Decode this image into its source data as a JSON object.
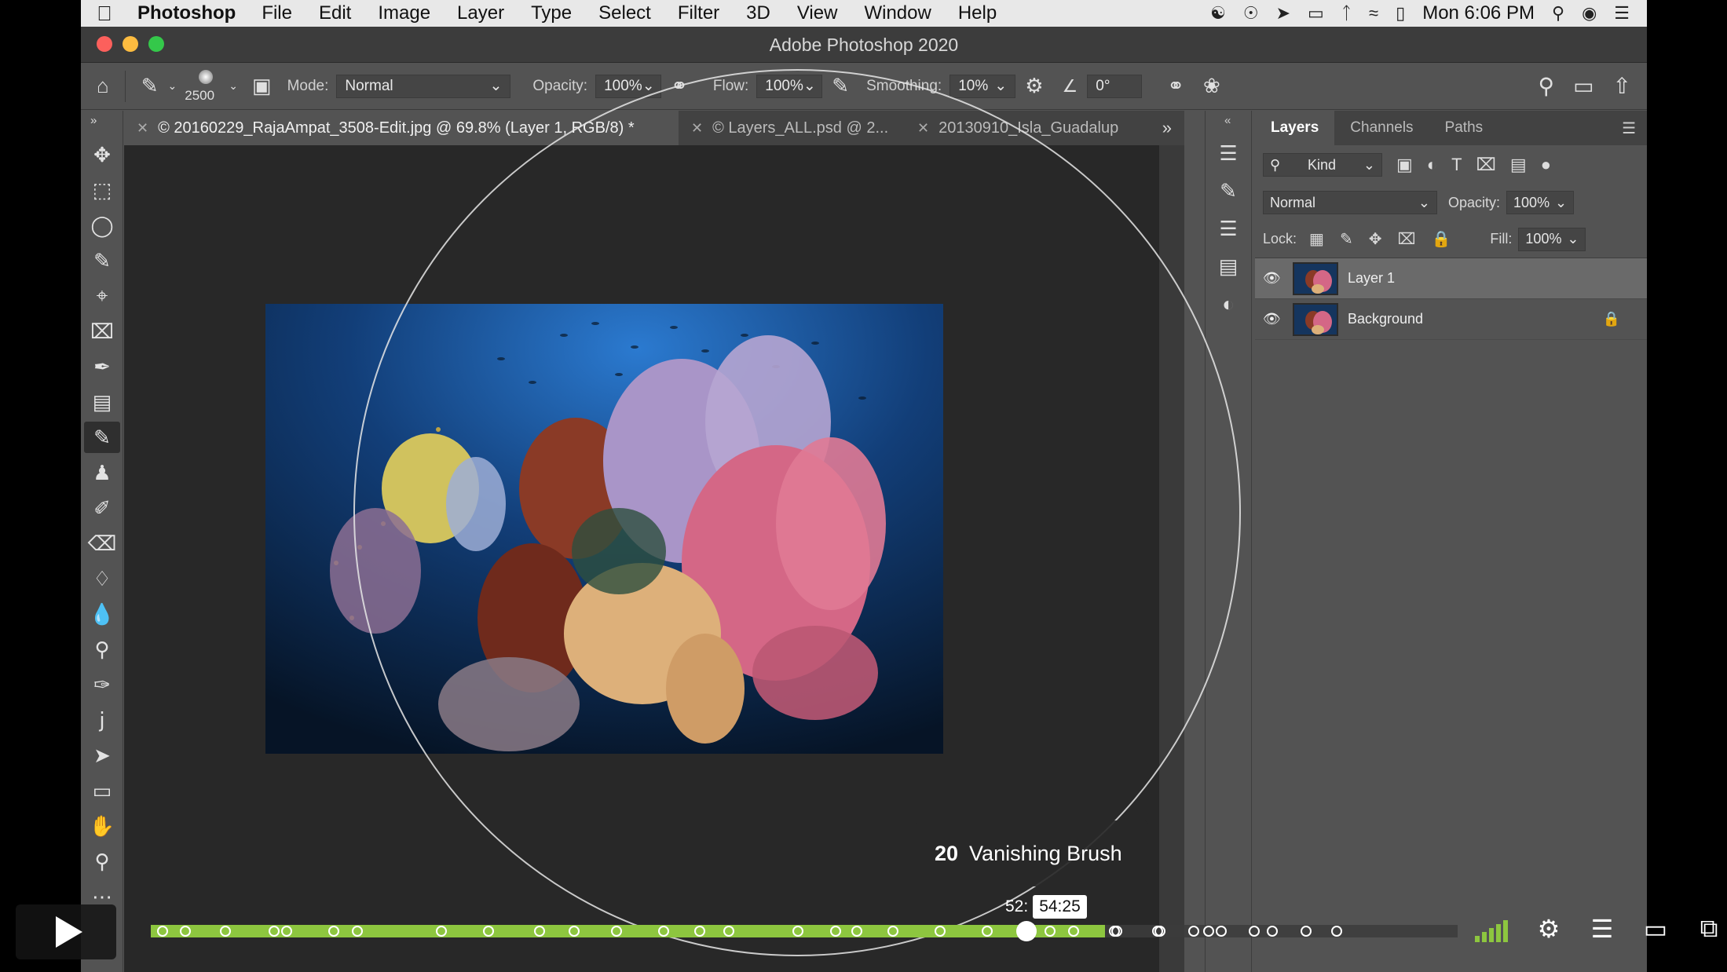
{
  "menubar": {
    "apple": "",
    "app_name": "Photoshop",
    "items": [
      "File",
      "Edit",
      "Image",
      "Layer",
      "Type",
      "Select",
      "Filter",
      "3D",
      "View",
      "Window",
      "Help"
    ],
    "clock": "Mon 6:06 PM"
  },
  "window": {
    "title": "Adobe Photoshop 2020"
  },
  "options": {
    "brush_size": "2500",
    "mode_label": "Mode:",
    "mode_value": "Normal",
    "opacity_label": "Opacity:",
    "opacity_value": "100%",
    "flow_label": "Flow:",
    "flow_value": "100%",
    "smoothing_label": "Smoothing:",
    "smoothing_value": "10%",
    "angle_value": "0°"
  },
  "tabs": [
    {
      "label": "© 20160229_RajaAmpat_3508-Edit.jpg @ 69.8% (Layer 1, RGB/8) *"
    },
    {
      "label": "© Layers_ALL.psd @ 2..."
    },
    {
      "label": "20130910_Isla_Guadalup"
    }
  ],
  "layers_panel": {
    "tabs": [
      "Layers",
      "Channels",
      "Paths"
    ],
    "filter_kind": "Kind",
    "blend_mode": "Normal",
    "opacity_label": "Opacity:",
    "opacity_value": "100%",
    "lock_label": "Lock:",
    "fill_label": "Fill:",
    "fill_value": "100%",
    "layers": [
      {
        "name": "Layer 1",
        "selected": true
      },
      {
        "name": "Background",
        "selected": false,
        "locked": true
      }
    ]
  },
  "player": {
    "chapter_number": "20",
    "chapter_title": "Vanishing Brush",
    "time_prefix": "52:",
    "hover_time": "54:25",
    "played_fraction": 0.73,
    "scrubber_fraction": 0.67,
    "chapter_fractions": [
      0.005,
      0.022,
      0.053,
      0.09,
      0.1,
      0.136,
      0.154,
      0.218,
      0.254,
      0.293,
      0.32,
      0.352,
      0.388,
      0.416,
      0.438,
      0.491,
      0.52,
      0.536,
      0.564,
      0.6,
      0.636,
      0.665,
      0.684,
      0.702,
      0.733,
      0.735,
      0.766,
      0.768,
      0.794,
      0.805,
      0.815,
      0.84,
      0.854,
      0.88,
      0.903
    ]
  }
}
